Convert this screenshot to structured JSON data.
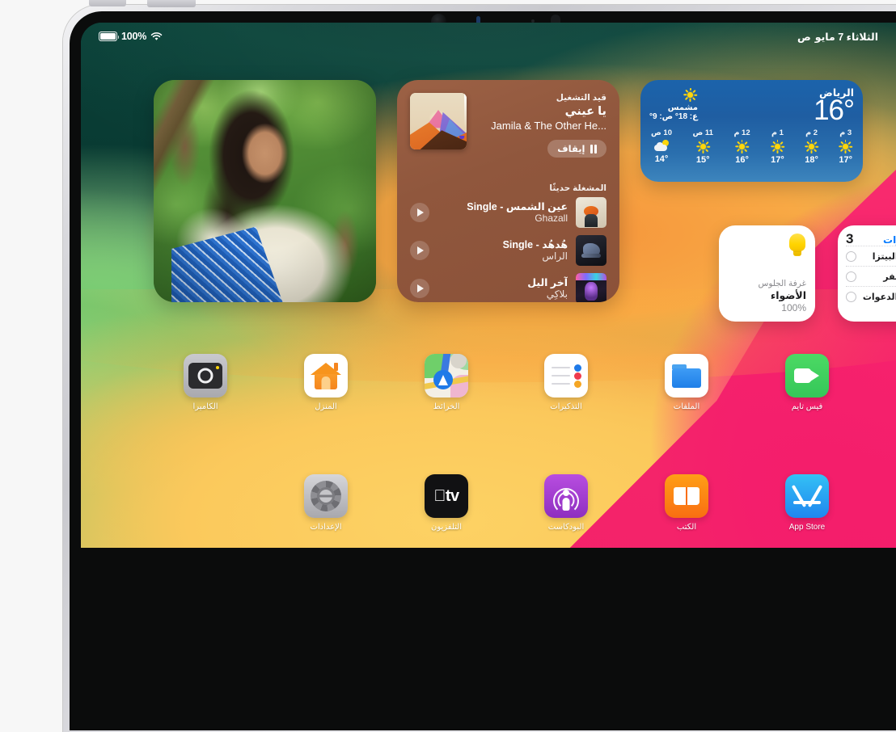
{
  "status_bar": {
    "battery_percent": "100%",
    "battery_icon": "battery-icon",
    "wifi_icon": "wifi-icon",
    "date": "الثلاثاء 7 مايو",
    "meridiem": "ص"
  },
  "widgets": {
    "photo": {
      "name": "photo-widget"
    },
    "music": {
      "note_icon": "music-note-icon",
      "now_playing_label": "قيد التشغيل",
      "track_title": "يا عيني",
      "artist": "Jamila & The Other He...",
      "pause_label": "إيقاف",
      "recent_label": "المشغلة حديثًا",
      "tracks": [
        {
          "title": "عين الشمس - Single",
          "subtitle": "Ghazall"
        },
        {
          "title": "هُدهُد - Single",
          "subtitle": "الراس"
        },
        {
          "title": "آخر اليل",
          "subtitle": "بلاكِي"
        }
      ]
    },
    "weather": {
      "city": "الرياض",
      "temperature": "16°",
      "condition": "مشمس",
      "high_low": "ع: 18° ص: 9°",
      "hours": [
        {
          "label": "10 ص",
          "icon": "partly-cloudy-icon",
          "temp": "14°"
        },
        {
          "label": "11 ص",
          "icon": "sun-icon",
          "temp": "15°"
        },
        {
          "label": "12 م",
          "icon": "sun-icon",
          "temp": "16°"
        },
        {
          "label": "1 م",
          "icon": "sun-icon",
          "temp": "17°"
        },
        {
          "label": "2 م",
          "icon": "sun-icon",
          "temp": "18°"
        },
        {
          "label": "3 م",
          "icon": "sun-icon",
          "temp": "17°"
        }
      ]
    },
    "home": {
      "bulb_icon": "lightbulb-icon",
      "room": "غرفة الجلوس",
      "title": "الأضواء",
      "value": "100%"
    },
    "reminders": {
      "title": "التذكيرات",
      "count": "3",
      "accent_color": "#007aff",
      "items": [
        {
          "text": "تحضير البيتزا"
        },
        {
          "text": "إذن السفر"
        },
        {
          "text": "إرسال الدعوات"
        }
      ]
    }
  },
  "apps": {
    "row1": [
      {
        "label": "الكاميرا",
        "icon": "camera-icon"
      },
      {
        "label": "المنزل",
        "icon": "home-icon"
      },
      {
        "label": "الخرائط",
        "icon": "maps-icon"
      },
      {
        "label": "التذكيرات",
        "icon": "reminders-icon"
      },
      {
        "label": "الملفات",
        "icon": "files-icon"
      },
      {
        "label": "فيس تايم",
        "icon": "facetime-icon"
      }
    ],
    "row2": [
      {
        "label": "الإعدادات",
        "icon": "settings-icon"
      },
      {
        "label": "التلفزيون",
        "icon": "tv-icon"
      },
      {
        "label": "البودكاست",
        "icon": "podcasts-icon"
      },
      {
        "label": "الكتب",
        "icon": "books-icon"
      },
      {
        "label": "App Store",
        "icon": "appstore-icon"
      }
    ]
  }
}
